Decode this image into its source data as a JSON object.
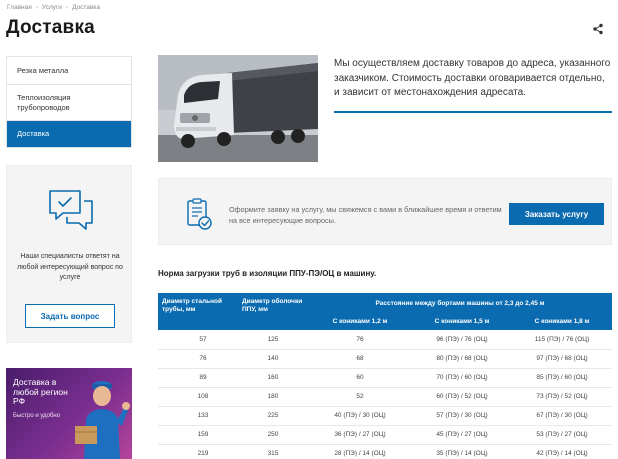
{
  "breadcrumb": [
    "Главная",
    "Услуги",
    "Доставка"
  ],
  "page_title": "Доставка",
  "sidebar": {
    "items": [
      {
        "label": "Резка металла"
      },
      {
        "label": "Теплоизоляция трубопроводов"
      },
      {
        "label": "Доставка"
      }
    ]
  },
  "ask_box": {
    "text": "Наши специалисты ответят на любой интересующий вопрос по услуге",
    "button": "Задать вопрос"
  },
  "promo": {
    "title": "Доставка в любой регион РФ",
    "subtitle": "Быстро и удобно"
  },
  "intro": {
    "text": "Мы осуществляем доставку товаров до адреса, указанного заказчиком. Стоимость доставки оговаривается отдельно, и зависит от местонахождения адресата."
  },
  "cta": {
    "text": "Оформите заявку на услугу, мы свяжемся с вами в ближайшее время и ответим на все интересующие вопросы.",
    "button": "Заказать услугу"
  },
  "table": {
    "title": "Норма загрузки труб в изоляции ППУ-ПЭ/ОЦ в машину.",
    "col1": "Диаметр стальной трубы, мм",
    "col2": "Диаметр оболочки ППУ, мм",
    "group": "Расстояние между бортами машины от 2,3 до 2,45 м",
    "sub1": "С кониками 1,2 м",
    "sub2": "С кониками 1,5 м",
    "sub3": "С кониками 1,8 м",
    "rows": [
      [
        "57",
        "125",
        "76",
        "96 (ПЭ) / 76 (ОЦ)",
        "115 (ПЭ) / 76 (ОЦ)"
      ],
      [
        "76",
        "140",
        "68",
        "80 (ПЭ) / 68 (ОЦ)",
        "97 (ПЭ) / 68 (ОЦ)"
      ],
      [
        "89",
        "160",
        "60",
        "70 (ПЭ) / 60 (ОЦ)",
        "85 (ПЭ) / 60 (ОЦ)"
      ],
      [
        "108",
        "180",
        "52",
        "60 (ПЭ) / 52 (ОЦ)",
        "73 (ПЭ) / 52 (ОЦ)"
      ],
      [
        "133",
        "225",
        "40 (ПЭ) / 30 (ОЦ)",
        "57 (ПЭ) / 30 (ОЦ)",
        "67 (ПЭ) / 30 (ОЦ)"
      ],
      [
        "159",
        "250",
        "36 (ПЭ) / 27 (ОЦ)",
        "45 (ПЭ) / 27 (ОЦ)",
        "53 (ПЭ) / 27 (ОЦ)"
      ],
      [
        "219",
        "315",
        "28 (ПЭ) / 14 (ОЦ)",
        "35 (ПЭ) / 14 (ОЦ)",
        "42 (ПЭ) / 14 (ОЦ)"
      ]
    ]
  },
  "icons": {
    "share": "share-icon",
    "chat": "chat-bubbles-icon",
    "clipboard": "clipboard-check-icon"
  },
  "colors": {
    "accent": "#0b6bb0",
    "panel": "#f4f4f4",
    "promo": "#7a2e8f"
  }
}
